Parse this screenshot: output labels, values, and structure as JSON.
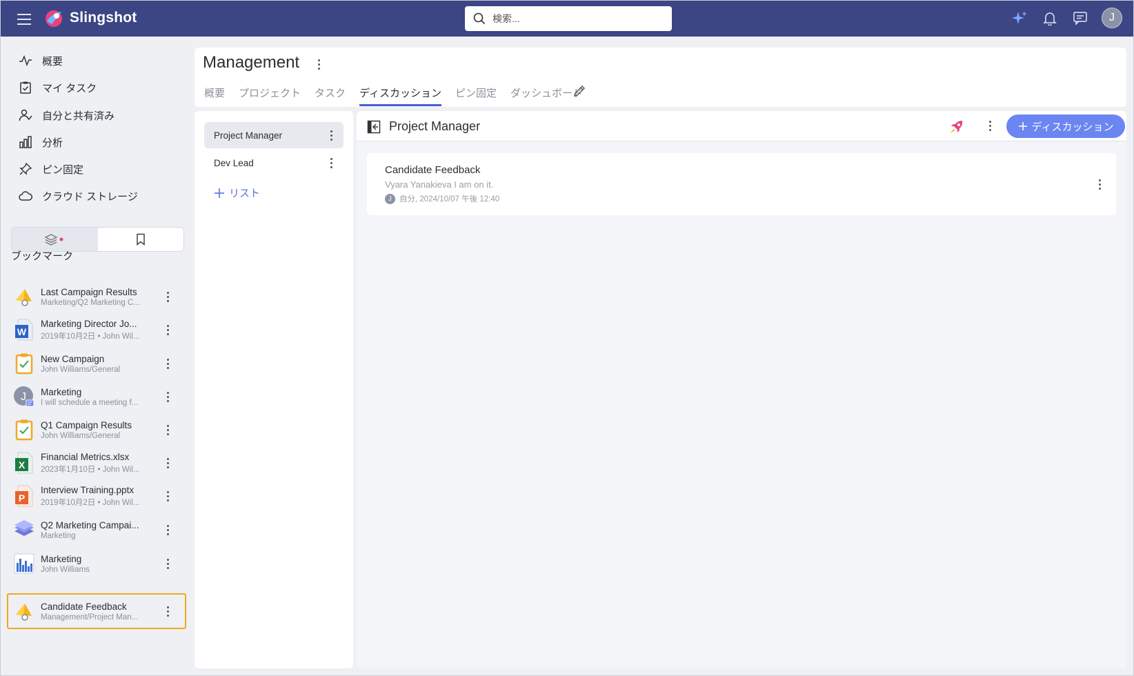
{
  "app": {
    "name": "Slingshot",
    "search_placeholder": "検索...",
    "user_initial": "J"
  },
  "nav": {
    "items": [
      {
        "label": "概要",
        "icon": "activity-icon"
      },
      {
        "label": "マイ タスク",
        "icon": "task-check-icon"
      },
      {
        "label": "自分と共有済み",
        "icon": "user-shared-icon"
      },
      {
        "label": "分析",
        "icon": "bar-chart-icon"
      },
      {
        "label": "ピン固定",
        "icon": "pin-icon"
      },
      {
        "label": "クラウド ストレージ",
        "icon": "cloud-icon"
      }
    ]
  },
  "bookmarks": {
    "title": "ブックマーク",
    "items": [
      {
        "title": "Last Campaign Results",
        "subtitle": "Marketing/Q2 Marketing C...",
        "icon": "megaphone-icon"
      },
      {
        "title": "Marketing Director Jo...",
        "subtitle": "2019年10月2日 • John Wil...",
        "icon": "word-file-icon"
      },
      {
        "title": "New Campaign",
        "subtitle": "John Williams/General",
        "icon": "clipboard-task-icon"
      },
      {
        "title": "Marketing",
        "subtitle": "I will schedule a meeting f...",
        "icon": "user-avatar-icon"
      },
      {
        "title": "Q1 Campaign Results",
        "subtitle": "John Williams/General",
        "icon": "clipboard-task-icon"
      },
      {
        "title": "Financial Metrics.xlsx",
        "subtitle": "2023年1月10日 • John Wil...",
        "icon": "excel-file-icon"
      },
      {
        "title": "Interview Training.pptx",
        "subtitle": "2019年10月2日 • John Wil...",
        "icon": "powerpoint-file-icon"
      },
      {
        "title": "Q2 Marketing Campai...",
        "subtitle": "Marketing",
        "icon": "layers-icon"
      },
      {
        "title": "Marketing",
        "subtitle": "John Williams",
        "icon": "dashboard-chart-icon"
      },
      {
        "title": "Candidate Feedback",
        "subtitle": "Management/Project Man...",
        "icon": "megaphone-icon"
      }
    ]
  },
  "workspace": {
    "title": "Management",
    "tabs": [
      "概要",
      "プロジェクト",
      "タスク",
      "ディスカッション",
      "ピン固定",
      "ダッシュボード"
    ],
    "active_tab": "ディスカッション"
  },
  "lists": {
    "items": [
      "Project Manager",
      "Dev Lead"
    ],
    "add_label": "リスト"
  },
  "main": {
    "list_title": "Project Manager",
    "new_button_label": "ディスカッション",
    "discussion": {
      "title": "Candidate Feedback",
      "preview": "Vyara Yanakieva I am on it.",
      "meta": "自分, 2024/10/07 午後 12:40",
      "avatar_initial": "J"
    }
  },
  "colors": {
    "topbar": "#3c4685",
    "accent": "#4a5cd4",
    "button": "#6b86f2",
    "highlight": "#f0a81e"
  }
}
